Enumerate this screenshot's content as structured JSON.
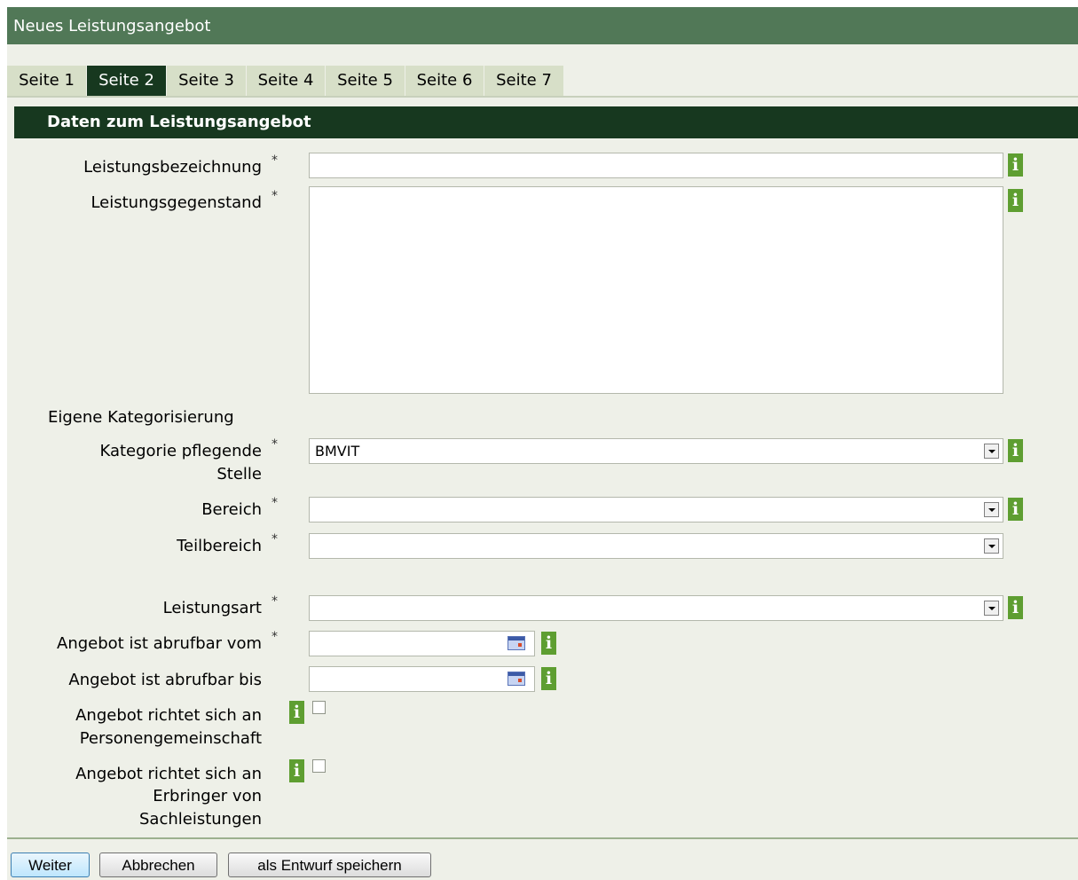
{
  "window": {
    "title": "Neues Leistungsangebot"
  },
  "tabs": [
    {
      "label": "Seite 1",
      "active": false
    },
    {
      "label": "Seite 2",
      "active": true
    },
    {
      "label": "Seite 3",
      "active": false
    },
    {
      "label": "Seite 4",
      "active": false
    },
    {
      "label": "Seite 5",
      "active": false
    },
    {
      "label": "Seite 6",
      "active": false
    },
    {
      "label": "Seite 7",
      "active": false
    }
  ],
  "section": {
    "title": "Daten zum Leistungsangebot"
  },
  "form": {
    "required_mark": "*",
    "info_glyph": "i",
    "leistungsbezeichnung": {
      "label": "Leistungsbezeichnung",
      "value": ""
    },
    "leistungsgegenstand": {
      "label": "Leistungsgegenstand",
      "value": ""
    },
    "eigene_kategorisierung": {
      "label": "Eigene Kategorisierung"
    },
    "kategorie": {
      "label_line1": "Kategorie pflegende",
      "label_line2": "Stelle",
      "value": "BMVIT"
    },
    "bereich": {
      "label": "Bereich",
      "value": ""
    },
    "teilbereich": {
      "label": "Teilbereich",
      "value": ""
    },
    "leistungsart": {
      "label": "Leistungsart",
      "value": ""
    },
    "abrufbar_vom": {
      "label": "Angebot ist abrufbar vom",
      "value": ""
    },
    "abrufbar_bis": {
      "label": "Angebot ist abrufbar bis",
      "value": ""
    },
    "personengemeinschaft": {
      "label_line1": "Angebot richtet sich an",
      "label_line2": "Personengemeinschaft",
      "checked": false
    },
    "sachleistungen": {
      "label_line1": "Angebot richtet sich an",
      "label_line2": "Erbringer von",
      "label_line3": "Sachleistungen",
      "checked": false
    }
  },
  "buttons": {
    "weiter": "Weiter",
    "abbrechen": "Abbrechen",
    "entwurf": "als Entwurf speichern"
  },
  "colors": {
    "titlebar": "#517857",
    "section_header": "#17381f",
    "tab_active": "#17381f",
    "tab_inactive": "#d7dfc8",
    "info_icon": "#5e9e31",
    "background": "#eef0e8"
  },
  "icons": [
    "info-icon",
    "calendar-icon",
    "dropdown-arrow-icon"
  ]
}
